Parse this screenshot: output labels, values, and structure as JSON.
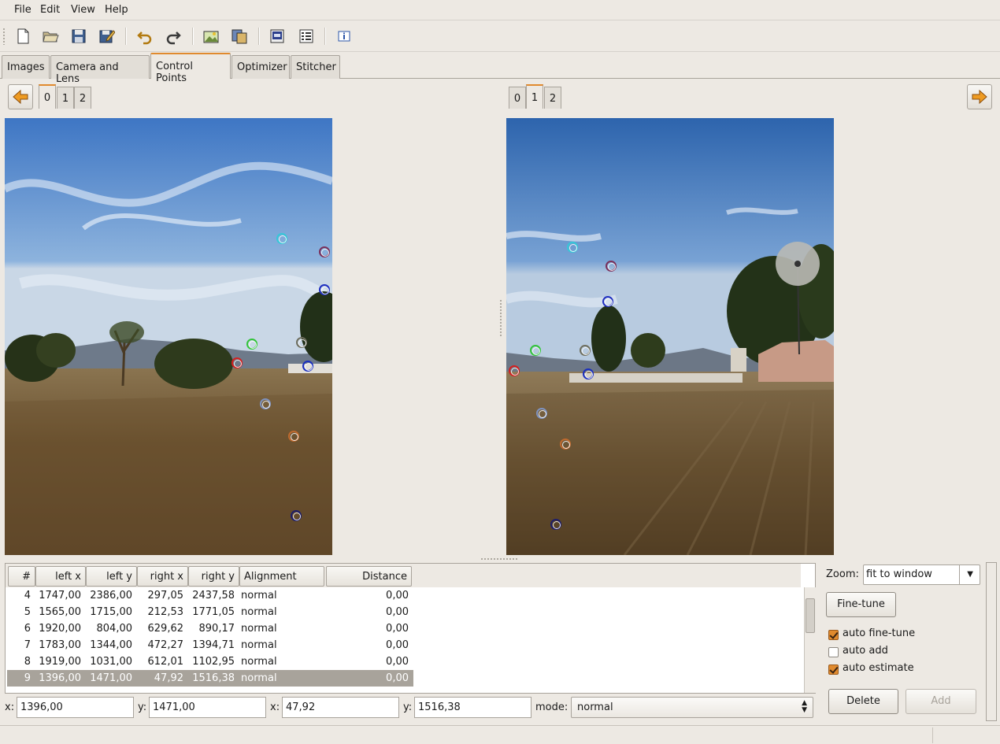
{
  "menu": {
    "file": "File",
    "edit": "Edit",
    "view": "View",
    "help": "Help"
  },
  "toolbar": {
    "icons": [
      "new-file-icon",
      "open-folder-icon",
      "save-icon",
      "save-as-icon",
      "undo-icon",
      "redo-icon",
      "add-image-icon",
      "add-time-series-icon",
      "preview-icon",
      "show-control-points-list-icon",
      "about-info-icon"
    ]
  },
  "tabs": [
    "Images",
    "Camera and Lens",
    "Control Points",
    "Optimizer",
    "Stitcher"
  ],
  "active_tab": "Control Points",
  "left_pane": {
    "image_tabs": [
      "0",
      "1",
      "2"
    ],
    "active": "0"
  },
  "right_pane": {
    "image_tabs": [
      "0",
      "1",
      "2"
    ],
    "active": "1"
  },
  "table": {
    "headers": [
      "#",
      "left x",
      "left y",
      "right x",
      "right y",
      "Alignment",
      "Distance"
    ],
    "rows": [
      {
        "id": "4",
        "lx": "1747,00",
        "ly": "2386,00",
        "rx": "297,05",
        "ry": "2437,58",
        "align": "normal",
        "dist": "0,00"
      },
      {
        "id": "5",
        "lx": "1565,00",
        "ly": "1715,00",
        "rx": "212,53",
        "ry": "1771,05",
        "align": "normal",
        "dist": "0,00"
      },
      {
        "id": "6",
        "lx": "1920,00",
        "ly": "804,00",
        "rx": "629,62",
        "ry": "890,17",
        "align": "normal",
        "dist": "0,00"
      },
      {
        "id": "7",
        "lx": "1783,00",
        "ly": "1344,00",
        "rx": "472,27",
        "ry": "1394,71",
        "align": "normal",
        "dist": "0,00"
      },
      {
        "id": "8",
        "lx": "1919,00",
        "ly": "1031,00",
        "rx": "612,01",
        "ry": "1102,95",
        "align": "normal",
        "dist": "0,00"
      },
      {
        "id": "9",
        "lx": "1396,00",
        "ly": "1471,00",
        "rx": "47,92",
        "ry": "1516,38",
        "align": "normal",
        "dist": "0,00"
      }
    ],
    "selected_row": "9"
  },
  "coords": {
    "x1_label": "x:",
    "x1": "1396,00",
    "y1_label": "y:",
    "y1": "1471,00",
    "x2_label": "x:",
    "x2": "47,92",
    "y2_label": "y:",
    "y2": "1516,38",
    "mode_label": "mode:",
    "mode": "normal"
  },
  "controls": {
    "zoom_label": "Zoom:",
    "zoom_value": "fit to window",
    "finetune_button": "Fine-tune",
    "auto_finetune": {
      "label": "auto fine-tune",
      "checked": true
    },
    "auto_add": {
      "label": "auto add",
      "checked": false
    },
    "auto_estimate": {
      "label": "auto estimate",
      "checked": true
    },
    "delete_button": "Delete",
    "add_button": "Add"
  },
  "control_point_colors": [
    "#35c8d8",
    "#7a2f5a",
    "#1f2fc0",
    "#33c43a",
    "#6e6e5e",
    "#d42020",
    "#1a2fbf",
    "#7f93c0",
    "#c06a2e",
    "#1e1e6a"
  ]
}
